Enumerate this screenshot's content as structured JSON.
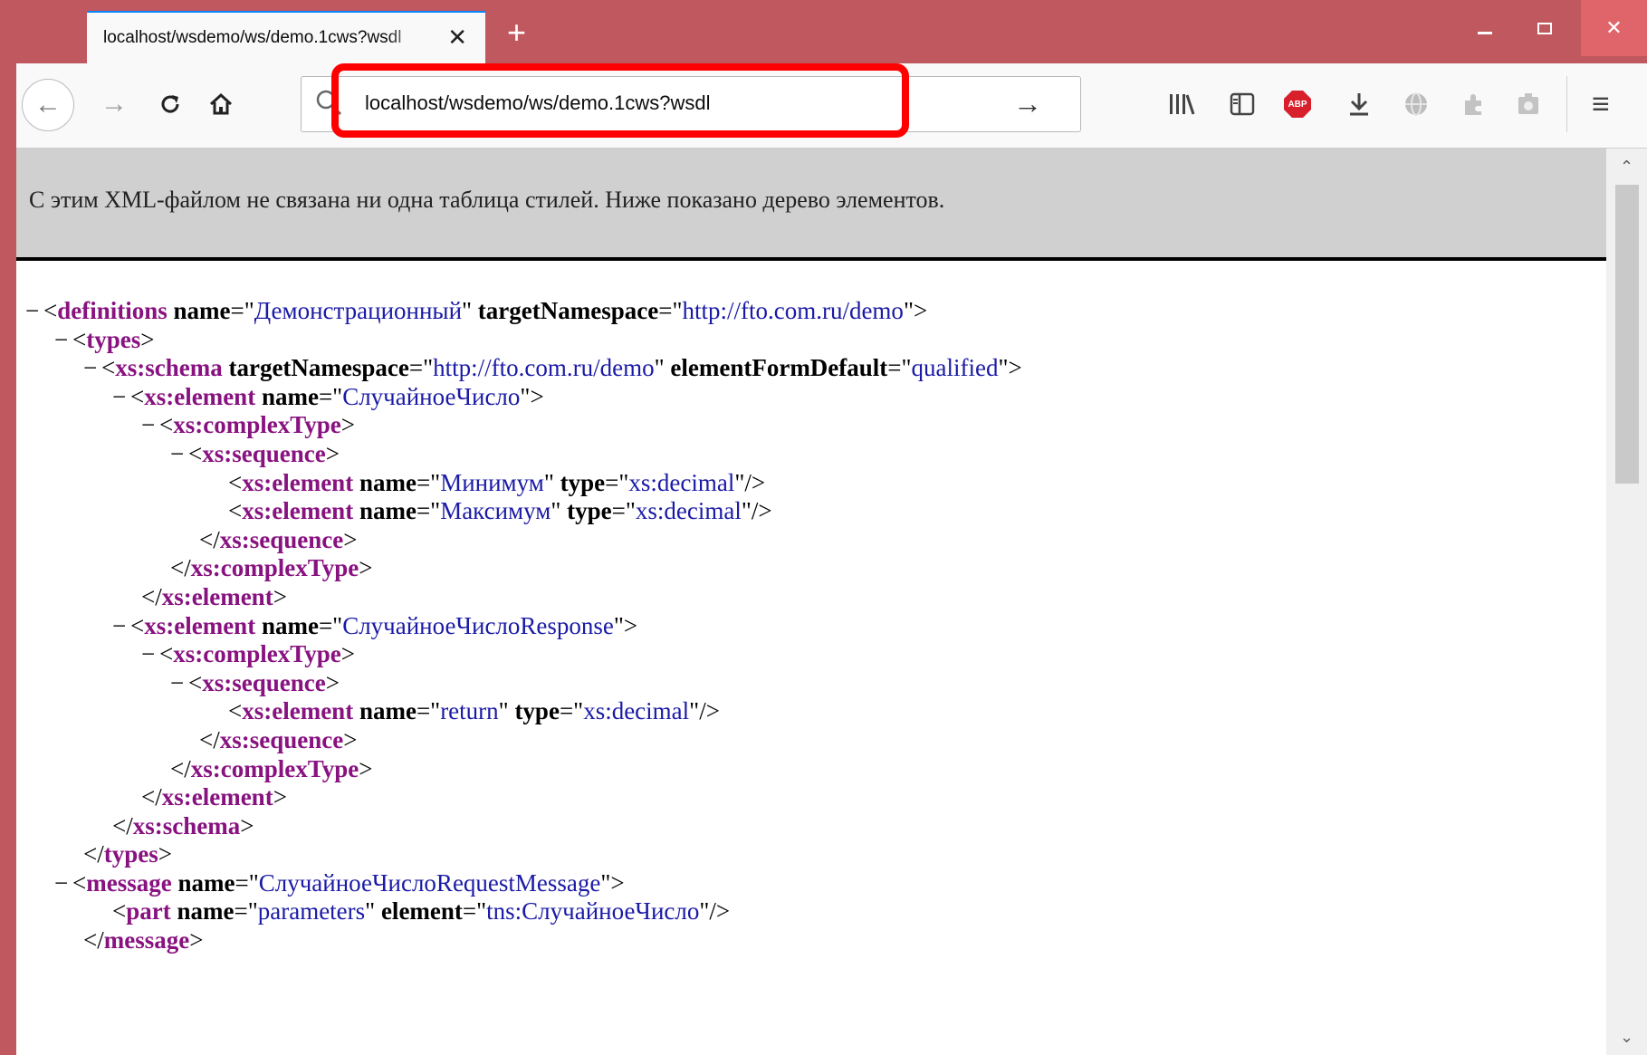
{
  "browser": {
    "tab_title": "localhost/wsdemo/ws/demo.1cws?wsdl",
    "close_tab_glyph": "✕",
    "new_tab_glyph": "+",
    "url": "localhost/wsdemo/ws/demo.1cws?wsdl",
    "back_glyph": "←",
    "forward_glyph": "→",
    "reload_glyph": "C",
    "go_glyph": "→",
    "window_close_glyph": "✕",
    "abp_label": "ABP",
    "menu_glyph": "≡",
    "toolbar_icons": [
      "library-icon",
      "sidebar-icon",
      "adblock-icon",
      "download-icon",
      "globe-icon",
      "extension-icon",
      "screenshot-icon",
      "menu-icon"
    ],
    "highlight_color": "#ff0000",
    "accent": "#c0585f"
  },
  "page": {
    "info_message": "С этим XML-файлом не связана ни одна таблица стилей. Ниже показано дерево элементов.",
    "xml_lines": [
      {
        "indent": 0,
        "toggle": true,
        "close": false,
        "tag": "definitions",
        "attrs": [
          {
            "n": "name",
            "v": "Демонстрационный"
          },
          {
            "n": "targetNamespace",
            "v": "http://fto.com.ru/demo"
          }
        ],
        "self": false
      },
      {
        "indent": 1,
        "toggle": true,
        "close": false,
        "tag": "types",
        "attrs": [],
        "self": false
      },
      {
        "indent": 2,
        "toggle": true,
        "close": false,
        "tag": "xs:schema",
        "attrs": [
          {
            "n": "targetNamespace",
            "v": "http://fto.com.ru/demo"
          },
          {
            "n": "elementFormDefault",
            "v": "qualified"
          }
        ],
        "self": false
      },
      {
        "indent": 3,
        "toggle": true,
        "close": false,
        "tag": "xs:element",
        "attrs": [
          {
            "n": "name",
            "v": "СлучайноеЧисло"
          }
        ],
        "self": false
      },
      {
        "indent": 4,
        "toggle": true,
        "close": false,
        "tag": "xs:complexType",
        "attrs": [],
        "self": false
      },
      {
        "indent": 5,
        "toggle": true,
        "close": false,
        "tag": "xs:sequence",
        "attrs": [],
        "self": false
      },
      {
        "indent": 6,
        "toggle": false,
        "close": false,
        "tag": "xs:element",
        "attrs": [
          {
            "n": "name",
            "v": "Минимум"
          },
          {
            "n": "type",
            "v": "xs:decimal"
          }
        ],
        "self": true
      },
      {
        "indent": 6,
        "toggle": false,
        "close": false,
        "tag": "xs:element",
        "attrs": [
          {
            "n": "name",
            "v": "Максимум"
          },
          {
            "n": "type",
            "v": "xs:decimal"
          }
        ],
        "self": true
      },
      {
        "indent": 5,
        "toggle": false,
        "close": true,
        "tag": "xs:sequence",
        "attrs": [],
        "self": false
      },
      {
        "indent": 4,
        "toggle": false,
        "close": true,
        "tag": "xs:complexType",
        "attrs": [],
        "self": false
      },
      {
        "indent": 3,
        "toggle": false,
        "close": true,
        "tag": "xs:element",
        "attrs": [],
        "self": false
      },
      {
        "indent": 3,
        "toggle": true,
        "close": false,
        "tag": "xs:element",
        "attrs": [
          {
            "n": "name",
            "v": "СлучайноеЧислоResponse"
          }
        ],
        "self": false
      },
      {
        "indent": 4,
        "toggle": true,
        "close": false,
        "tag": "xs:complexType",
        "attrs": [],
        "self": false
      },
      {
        "indent": 5,
        "toggle": true,
        "close": false,
        "tag": "xs:sequence",
        "attrs": [],
        "self": false
      },
      {
        "indent": 6,
        "toggle": false,
        "close": false,
        "tag": "xs:element",
        "attrs": [
          {
            "n": "name",
            "v": "return"
          },
          {
            "n": "type",
            "v": "xs:decimal"
          }
        ],
        "self": true
      },
      {
        "indent": 5,
        "toggle": false,
        "close": true,
        "tag": "xs:sequence",
        "attrs": [],
        "self": false
      },
      {
        "indent": 4,
        "toggle": false,
        "close": true,
        "tag": "xs:complexType",
        "attrs": [],
        "self": false
      },
      {
        "indent": 3,
        "toggle": false,
        "close": true,
        "tag": "xs:element",
        "attrs": [],
        "self": false
      },
      {
        "indent": 2,
        "toggle": false,
        "close": true,
        "tag": "xs:schema",
        "attrs": [],
        "self": false
      },
      {
        "indent": 1,
        "toggle": false,
        "close": true,
        "tag": "types",
        "attrs": [],
        "self": false
      },
      {
        "indent": 1,
        "toggle": true,
        "close": false,
        "tag": "message",
        "attrs": [
          {
            "n": "name",
            "v": "СлучайноеЧислоRequestMessage"
          }
        ],
        "self": false
      },
      {
        "indent": 2,
        "toggle": false,
        "close": false,
        "tag": "part",
        "attrs": [
          {
            "n": "name",
            "v": "parameters"
          },
          {
            "n": "element",
            "v": "tns:СлучайноеЧисло"
          }
        ],
        "self": true
      },
      {
        "indent": 1,
        "toggle": false,
        "close": true,
        "tag": "message",
        "attrs": [],
        "self": false
      }
    ]
  }
}
